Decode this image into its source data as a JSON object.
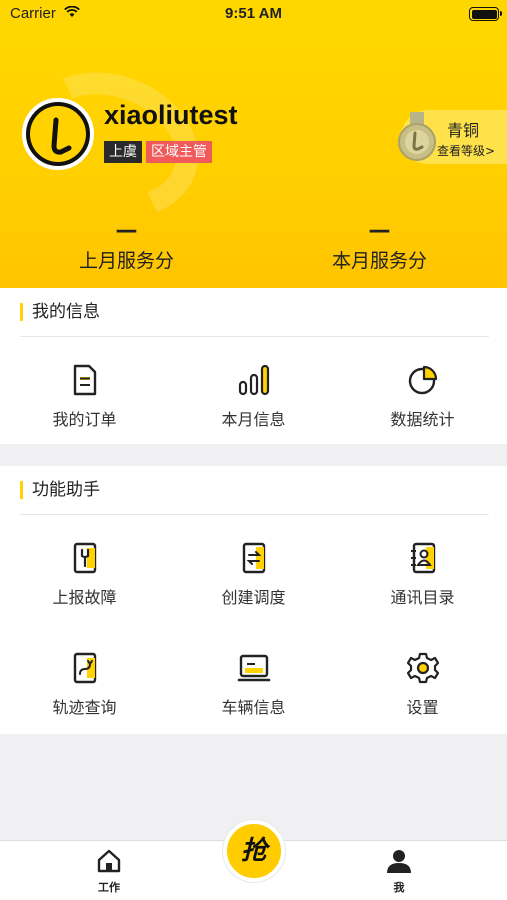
{
  "status_bar": {
    "carrier": "Carrier",
    "time": "9:51 AM"
  },
  "profile": {
    "username": "xiaoliutest",
    "city_tag": "上虞",
    "role_tag": "区域主管",
    "level_name": "青铜",
    "level_link": "查看等级>"
  },
  "scores": [
    {
      "value": "—",
      "label": "上月服务分"
    },
    {
      "value": "—",
      "label": "本月服务分"
    }
  ],
  "my_info": {
    "title": "我的信息",
    "items": [
      {
        "label": "我的订单",
        "icon": "order-document-icon"
      },
      {
        "label": "本月信息",
        "icon": "signal-bars-icon"
      },
      {
        "label": "数据统计",
        "icon": "pie-chart-icon"
      }
    ]
  },
  "functions": {
    "title": "功能助手",
    "items": [
      {
        "label": "上报故障",
        "icon": "wrench-report-icon"
      },
      {
        "label": "创建调度",
        "icon": "dispatch-document-icon"
      },
      {
        "label": "通讯目录",
        "icon": "contacts-book-icon"
      },
      {
        "label": "轨迹查询",
        "icon": "route-track-icon"
      },
      {
        "label": "车辆信息",
        "icon": "vehicle-screen-icon"
      },
      {
        "label": "设置",
        "icon": "gear-icon"
      }
    ]
  },
  "tab_bar": {
    "work_label": "工作",
    "grab_label": "抢",
    "me_label": "我"
  },
  "colors": {
    "accent": "#ffd200",
    "role_tag": "#f05a5a",
    "city_tag": "#2a2a2a"
  }
}
